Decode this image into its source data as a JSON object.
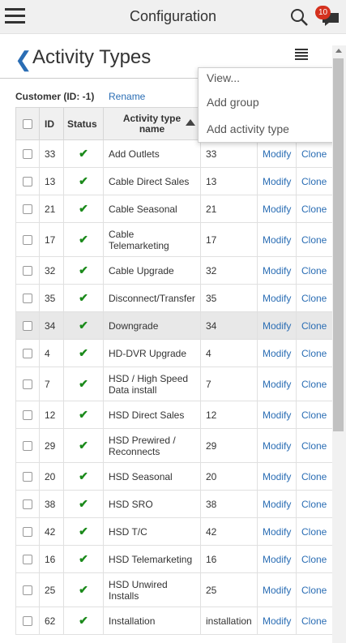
{
  "app": {
    "title": "Configuration",
    "notification_count": "10"
  },
  "page": {
    "title": "Activity Types",
    "customer_label": "Customer (ID: -1)",
    "rename_label": "Rename"
  },
  "menu": {
    "items": [
      "View...",
      "Add group",
      "Add activity type"
    ]
  },
  "table": {
    "headers": {
      "id": "ID",
      "status": "Status",
      "name": "Activity type name"
    },
    "rows": [
      {
        "id": "33",
        "name": "Add Outlets",
        "code": "33",
        "modify": "Modify",
        "clone": "Clone",
        "status": "✔"
      },
      {
        "id": "13",
        "name": "Cable Direct Sales",
        "code": "13",
        "modify": "Modify",
        "clone": "Clone",
        "status": "✔"
      },
      {
        "id": "21",
        "name": "Cable Seasonal",
        "code": "21",
        "modify": "Modify",
        "clone": "Clone",
        "status": "✔"
      },
      {
        "id": "17",
        "name": "Cable Telemarketing",
        "code": "17",
        "modify": "Modify",
        "clone": "Clone",
        "status": "✔"
      },
      {
        "id": "32",
        "name": "Cable Upgrade",
        "code": "32",
        "modify": "Modify",
        "clone": "Clone",
        "status": "✔"
      },
      {
        "id": "35",
        "name": "Disconnect/Transfer",
        "code": "35",
        "modify": "Modify",
        "clone": "Clone",
        "status": "✔"
      },
      {
        "id": "34",
        "name": "Downgrade",
        "code": "34",
        "modify": "Modify",
        "clone": "Clone",
        "status": "✔"
      },
      {
        "id": "4",
        "name": "HD-DVR Upgrade",
        "code": "4",
        "modify": "Modify",
        "clone": "Clone",
        "status": "✔"
      },
      {
        "id": "7",
        "name": "HSD / High Speed Data install",
        "code": "7",
        "modify": "Modify",
        "clone": "Clone",
        "status": "✔"
      },
      {
        "id": "12",
        "name": "HSD Direct Sales",
        "code": "12",
        "modify": "Modify",
        "clone": "Clone",
        "status": "✔"
      },
      {
        "id": "29",
        "name": "HSD Prewired / Reconnects",
        "code": "29",
        "modify": "Modify",
        "clone": "Clone",
        "status": "✔"
      },
      {
        "id": "20",
        "name": "HSD Seasonal",
        "code": "20",
        "modify": "Modify",
        "clone": "Clone",
        "status": "✔"
      },
      {
        "id": "38",
        "name": "HSD SRO",
        "code": "38",
        "modify": "Modify",
        "clone": "Clone",
        "status": "✔"
      },
      {
        "id": "42",
        "name": "HSD T/C",
        "code": "42",
        "modify": "Modify",
        "clone": "Clone",
        "status": "✔"
      },
      {
        "id": "16",
        "name": "HSD Telemarketing",
        "code": "16",
        "modify": "Modify",
        "clone": "Clone",
        "status": "✔"
      },
      {
        "id": "25",
        "name": "HSD Unwired Installs",
        "code": "25",
        "modify": "Modify",
        "clone": "Clone",
        "status": "✔"
      },
      {
        "id": "62",
        "name": "Installation",
        "code": "installation",
        "modify": "Modify",
        "clone": "Clone",
        "status": "✔"
      }
    ]
  }
}
